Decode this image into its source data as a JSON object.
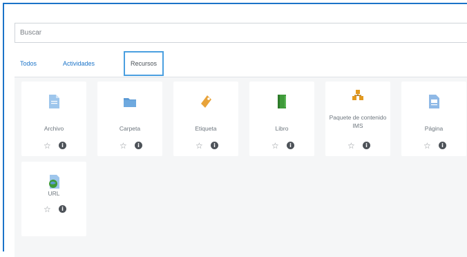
{
  "search": {
    "placeholder": "Buscar"
  },
  "tabs": [
    {
      "label": "Todos"
    },
    {
      "label": "Actividades"
    },
    {
      "label": "Recursos"
    }
  ],
  "resources": [
    {
      "label": "Archivo",
      "icon": "file-icon"
    },
    {
      "label": "Carpeta",
      "icon": "folder-icon"
    },
    {
      "label": "Etiqueta",
      "icon": "label-tag-icon"
    },
    {
      "label": "Libro",
      "icon": "book-icon"
    },
    {
      "label": "Paquete de contenido IMS",
      "icon": "ims-package-icon"
    },
    {
      "label": "Página",
      "icon": "page-icon"
    },
    {
      "label": "URL",
      "icon": "url-globe-icon"
    }
  ],
  "colors": {
    "accent": "#1a73c8",
    "file": "#9ec6ec",
    "folder": "#5d9bd5",
    "tag": "#e8a33a",
    "book": "#3f9b3a",
    "package": "#e39a1f"
  }
}
